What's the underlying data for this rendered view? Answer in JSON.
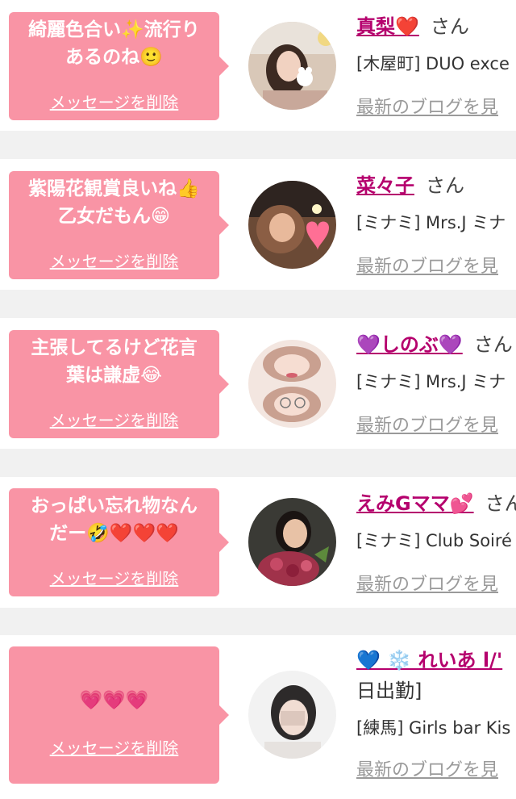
{
  "colors": {
    "bubble": "#f994a5",
    "link": "#b5006d",
    "background": "#f1f1f1"
  },
  "delete_label": "メッセージを削除",
  "blog_label": "最新のブログを見",
  "honorific": "さん",
  "cards": [
    {
      "message": "綺麗色合い✨流行り\nあるのね🙂",
      "name": "真梨❤️",
      "shop": "[木屋町] DUO exce",
      "avatar": "portrait-woman-bunny-sticker"
    },
    {
      "message": "紫陽花観賞良いね👍\n乙女だもん😁",
      "name": "菜々子",
      "shop": "[ミナミ] Mrs.J ミナ",
      "avatar": "portrait-woman-heart-sticker"
    },
    {
      "message": "主張してるけど花言\n葉は謙虚😂",
      "name": "💜しのぶ💜",
      "shop": "[ミナミ] Mrs.J ミナ",
      "avatar": "portrait-woman-glasses"
    },
    {
      "message": "おっぱい忘れ物なん\nだー🤣❤️❤️❤️",
      "name": "えみGママ💕",
      "shop": "[ミナミ] Club Soiré",
      "avatar": "portrait-woman-roses"
    },
    {
      "message": "💗💗💗",
      "name": "💙 ❄️ れいあ l/'",
      "name_line2": "日出勤]",
      "shop": "[練馬] Girls bar Kis",
      "avatar": "portrait-woman-blurred"
    }
  ]
}
